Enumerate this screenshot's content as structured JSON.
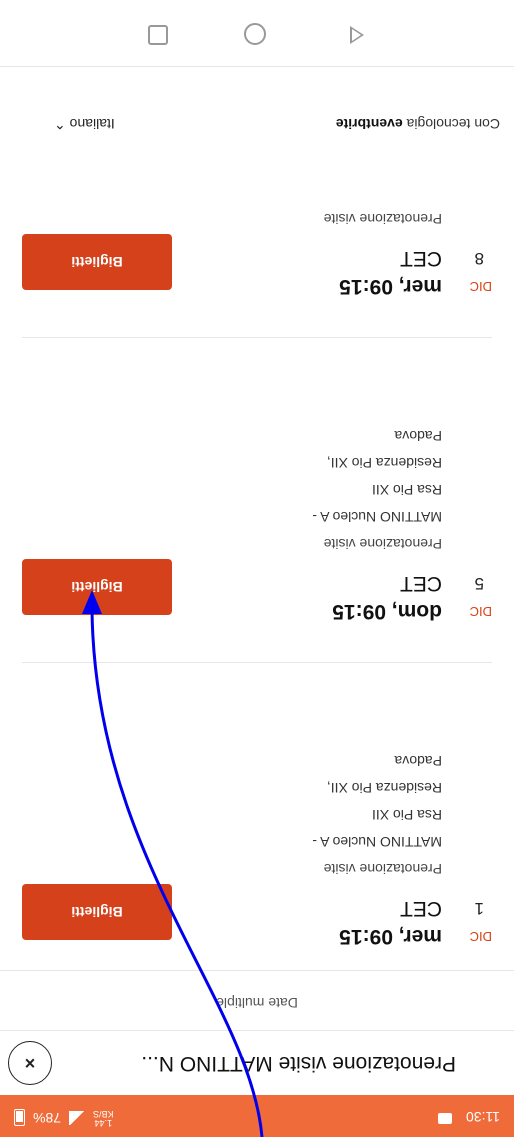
{
  "status_bar": {
    "time": "11:30",
    "net_speed_top": "1.44",
    "net_speed_bottom": "KB/S",
    "battery": "78%"
  },
  "header": {
    "title": "Prenotazione visite MATTINO N...",
    "close_symbol": "×"
  },
  "multiple_dates_label": "Date multiple",
  "events": [
    {
      "month": "DIC",
      "day": "1",
      "datetime": "mer, 09:15",
      "tz": "CET",
      "kind": "Prenotazione visite",
      "name_line1": "MATTINO Nucleo A -",
      "name_line2": "Rsa Pio XII",
      "venue": "Residenza Pio XII,",
      "city": "Padova",
      "button": "Biglietti"
    },
    {
      "month": "DIC",
      "day": "5",
      "datetime": "dom, 09:15",
      "tz": "CET",
      "kind": "Prenotazione visite",
      "name_line1": "MATTINO Nucleo A -",
      "name_line2": "Rsa Pio XII",
      "venue": "Residenza Pio XII,",
      "city": "Padova",
      "button": "Biglietti"
    },
    {
      "month": "DIC",
      "day": "8",
      "datetime": "mer, 09:15",
      "tz": "CET",
      "kind": "Prenotazione visite",
      "button": "Biglietti"
    }
  ],
  "footer": {
    "tech_prefix": "Con tecnologia ",
    "tech_brand": "eventbrite",
    "language": "Italiano",
    "language_icon": "chevron-up-icon"
  },
  "nav": {
    "back": "back-icon",
    "home": "home-icon",
    "recent": "recent-apps-icon"
  },
  "colors": {
    "accent": "#d4411b",
    "status_bar": "#ef6b3a",
    "arrow": "#0000ee"
  }
}
